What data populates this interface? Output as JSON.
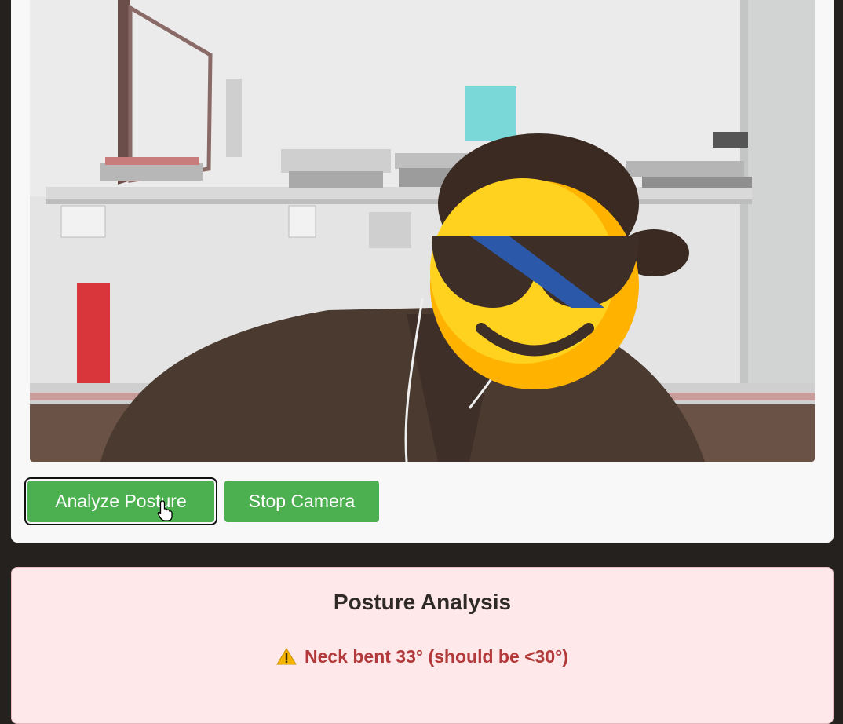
{
  "camera": {
    "analyze_label": "Analyze Posture",
    "stop_label": "Stop Camera"
  },
  "analysis": {
    "title": "Posture Analysis",
    "alert_text": "Neck bent 33° (should be <30°)",
    "alert_icon": "warning-icon"
  },
  "colors": {
    "button": "#4caf50",
    "alert_text": "#b23a3a",
    "alert_bg": "#ffe8ea",
    "page_bg": "#24211f"
  }
}
